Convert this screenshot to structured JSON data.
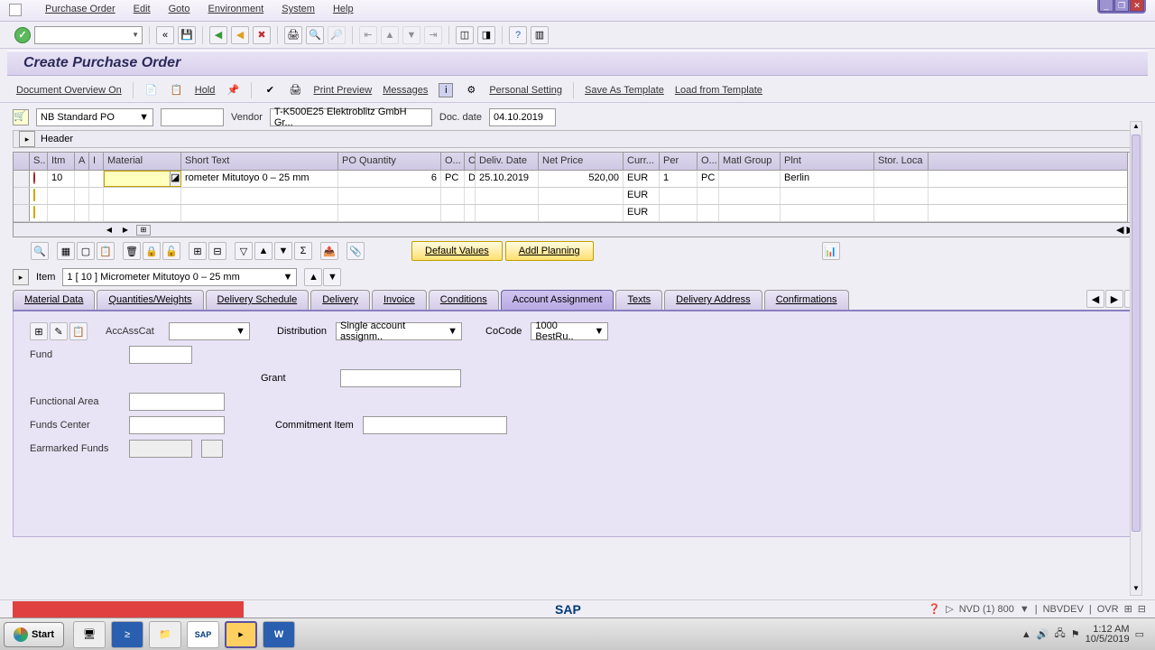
{
  "menu": {
    "purchase_order": "Purchase Order",
    "edit": "Edit",
    "goto": "Goto",
    "environment": "Environment",
    "system": "System",
    "help": "Help"
  },
  "title": "Create Purchase Order",
  "app_toolbar": {
    "doc_overview": "Document Overview On",
    "hold": "Hold",
    "print_preview": "Print Preview",
    "messages": "Messages",
    "personal_setting": "Personal Setting",
    "save_template": "Save As Template",
    "load_template": "Load from Template"
  },
  "doc": {
    "order_type": "NB Standard PO",
    "ponum": "",
    "vendor_label": "Vendor",
    "vendor_value": "T-K500E25 Elektroblitz GmbH Gr...",
    "doc_date_label": "Doc. date",
    "doc_date": "04.10.2019",
    "header_label": "Header"
  },
  "grid": {
    "cols": {
      "s": "S..",
      "itm": "Itm",
      "a": "A",
      "i": "I",
      "material": "Material",
      "short_text": "Short Text",
      "po_qty": "PO Quantity",
      "oun": "O...",
      "c": "C",
      "deliv_date": "Deliv. Date",
      "net_price": "Net Price",
      "curr": "Curr...",
      "per": "Per",
      "opu": "O...",
      "matl_group": "Matl Group",
      "plnt": "Plnt",
      "stor_loc": "Stor. Loca"
    },
    "row1": {
      "itm": "10",
      "short_text": "rometer Mitutoyo 0 – 25 mm",
      "qty": "6",
      "oun": "PC",
      "c": "D",
      "deliv": "25.10.2019",
      "price": "520,00",
      "curr": "EUR",
      "per": "1",
      "opu": "PC",
      "plnt": "Berlin"
    },
    "row2_curr": "EUR",
    "row3_curr": "EUR"
  },
  "grid_buttons": {
    "default_values": "Default Values",
    "addl_planning": "Addl Planning"
  },
  "item_detail": {
    "label": "Item",
    "selected": "1 [ 10 ] Micrometer Mitutoyo 0 – 25 mm"
  },
  "tabs": {
    "material_data": "Material Data",
    "qty_weights": "Quantities/Weights",
    "deliv_schedule": "Delivery Schedule",
    "delivery": "Delivery",
    "invoice": "Invoice",
    "conditions": "Conditions",
    "account_assign": "Account Assignment",
    "texts": "Texts",
    "deliv_address": "Delivery Address",
    "confirmations": "Confirmations"
  },
  "acct": {
    "acccat_label": "AccAssCat",
    "dist_label": "Distribution",
    "dist_value": "Single account assignm..",
    "cocode_label": "CoCode",
    "cocode_value": "1000 BestRu..",
    "fund": "Fund",
    "grant": "Grant",
    "funcarea": "Functional Area",
    "fundscenter": "Funds Center",
    "commitment": "Commitment Item",
    "earmarked": "Earmarked Funds"
  },
  "status": {
    "client": "NVD (1) 800",
    "server": "NBVDEV",
    "ovr": "OVR"
  },
  "taskbar": {
    "start": "Start",
    "time": "1:12 AM",
    "date": "10/5/2019"
  }
}
